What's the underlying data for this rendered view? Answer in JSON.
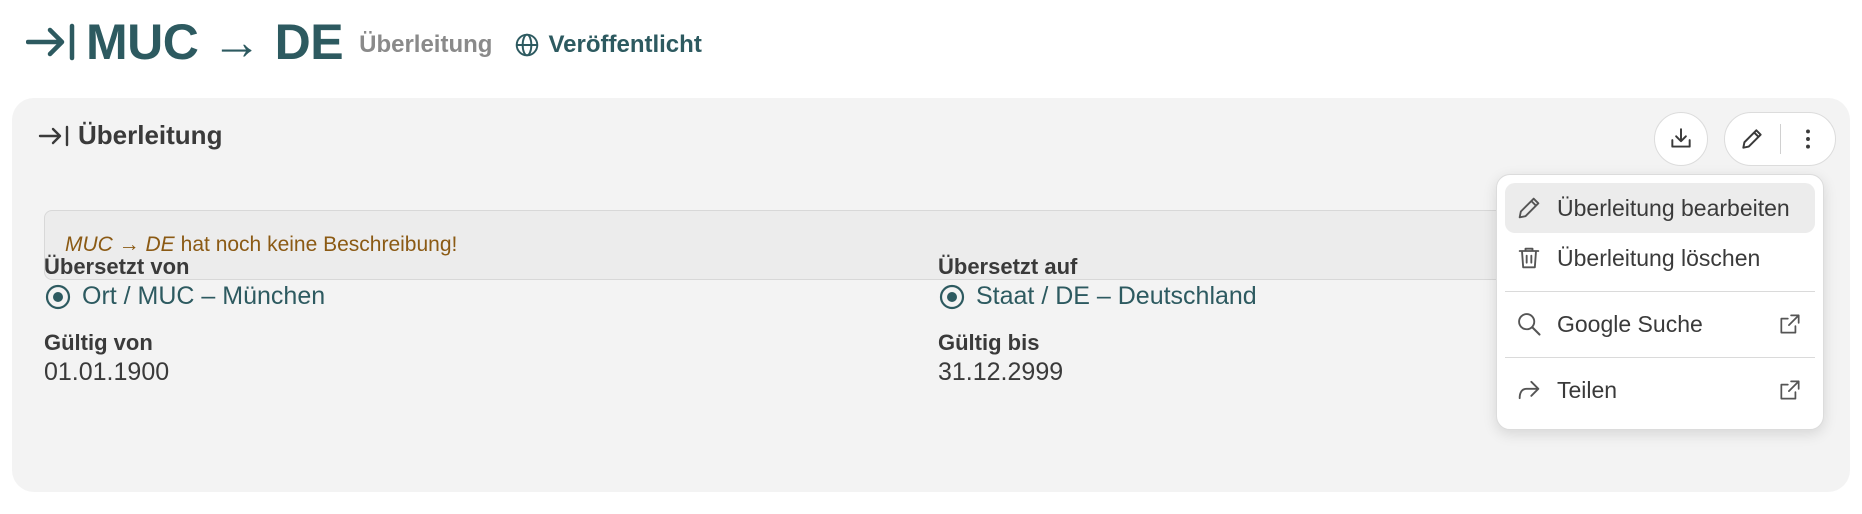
{
  "header": {
    "title": "MUC → DE",
    "type": "Überleitung",
    "status": "Veröffentlicht"
  },
  "card": {
    "title": "Überleitung",
    "description": {
      "name": "MUC → DE",
      "text": "hat noch keine Beschreibung!"
    },
    "fields": {
      "from_label": "Übersetzt von",
      "from_value": "Ort / MUC – München",
      "to_label": "Übersetzt auf",
      "to_value": "Staat / DE – Deutschland",
      "valid_from_label": "Gültig von",
      "valid_from_value": "01.01.1900",
      "valid_to_label": "Gültig bis",
      "valid_to_value": "31.12.2999"
    }
  },
  "menu": {
    "items": [
      {
        "label": "Überleitung bearbeiten",
        "icon": "pencil-icon"
      },
      {
        "label": "Überleitung löschen",
        "icon": "trash-icon"
      },
      {
        "label": "Google Suche",
        "icon": "search-icon"
      },
      {
        "label": "Teilen",
        "icon": "share-icon"
      }
    ]
  },
  "colors": {
    "accent": "#2d5a60",
    "warning_text": "#8b5a14",
    "card_bg": "#f3f3f3"
  }
}
